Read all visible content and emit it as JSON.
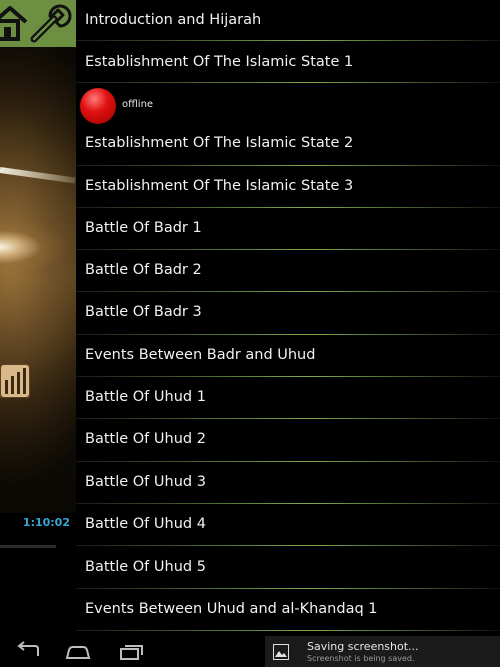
{
  "player": {
    "elapsed_time": "1:10:02"
  },
  "status": {
    "offline_label": "offline"
  },
  "tracks": [
    "Introduction and Hijarah",
    "Establishment Of The Islamic State 1",
    "Establishment Of The Islamic State 2",
    "Establishment Of The Islamic State 3",
    "Battle Of Badr 1",
    "Battle Of Badr 2",
    "Battle Of Badr 3",
    "Events Between Badr and Uhud",
    "Battle Of Uhud 1",
    "Battle Of Uhud 2",
    "Battle Of Uhud 3",
    "Battle Of Uhud 4",
    "Battle Of Uhud 5",
    "Events Between Uhud and al-Khandaq 1"
  ],
  "notification": {
    "title": "Saving screenshot...",
    "subtitle": "Screenshot is being saved."
  },
  "icons": {
    "home": "home-icon",
    "settings": "wrench-icon",
    "back": "back-icon",
    "nav_home": "home-icon",
    "recents": "recents-icon",
    "image": "image-icon"
  },
  "colors": {
    "toolbar": "#6d8f42",
    "time": "#39a6d4",
    "offline_indicator": "#e01010",
    "divider_accent": "#7fa94e"
  }
}
